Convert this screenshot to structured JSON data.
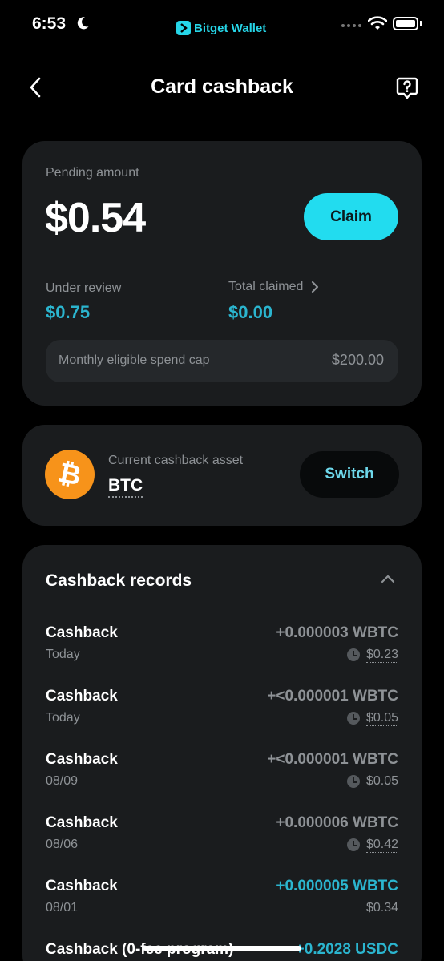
{
  "status_bar": {
    "time": "6:53",
    "brand": "Bitget Wallet"
  },
  "header": {
    "title": "Card cashback"
  },
  "pending": {
    "label": "Pending amount",
    "amount": "$0.54",
    "claim_label": "Claim",
    "under_review_label": "Under review",
    "under_review_value": "$0.75",
    "total_claimed_label": "Total claimed",
    "total_claimed_value": "$0.00",
    "cap_label": "Monthly eligible spend cap",
    "cap_value": "$200.00"
  },
  "asset": {
    "label": "Current cashback asset",
    "value": "BTC",
    "switch_label": "Switch"
  },
  "records": {
    "title": "Cashback records",
    "items": [
      {
        "title": "Cashback",
        "date": "Today",
        "amount": "+0.000003 WBTC",
        "usd": "$0.23"
      },
      {
        "title": "Cashback",
        "date": "Today",
        "amount": "+<0.000001 WBTC",
        "usd": "$0.05"
      },
      {
        "title": "Cashback",
        "date": "08/09",
        "amount": "+<0.000001 WBTC",
        "usd": "$0.05"
      },
      {
        "title": "Cashback",
        "date": "08/06",
        "amount": "+0.000006 WBTC",
        "usd": "$0.42"
      },
      {
        "title": "Cashback",
        "date": "08/01",
        "amount": "+0.000005 WBTC",
        "usd": "$0.34"
      },
      {
        "title": "Cashback (0-fee program)",
        "date": "",
        "amount": "+0.2028 USDC",
        "usd": ""
      }
    ]
  },
  "colors": {
    "accent": "#22dcef",
    "accent_text": "#2bb5cf",
    "card_bg": "#1a1c1e",
    "background": "#000000",
    "btc": "#f7931a"
  }
}
